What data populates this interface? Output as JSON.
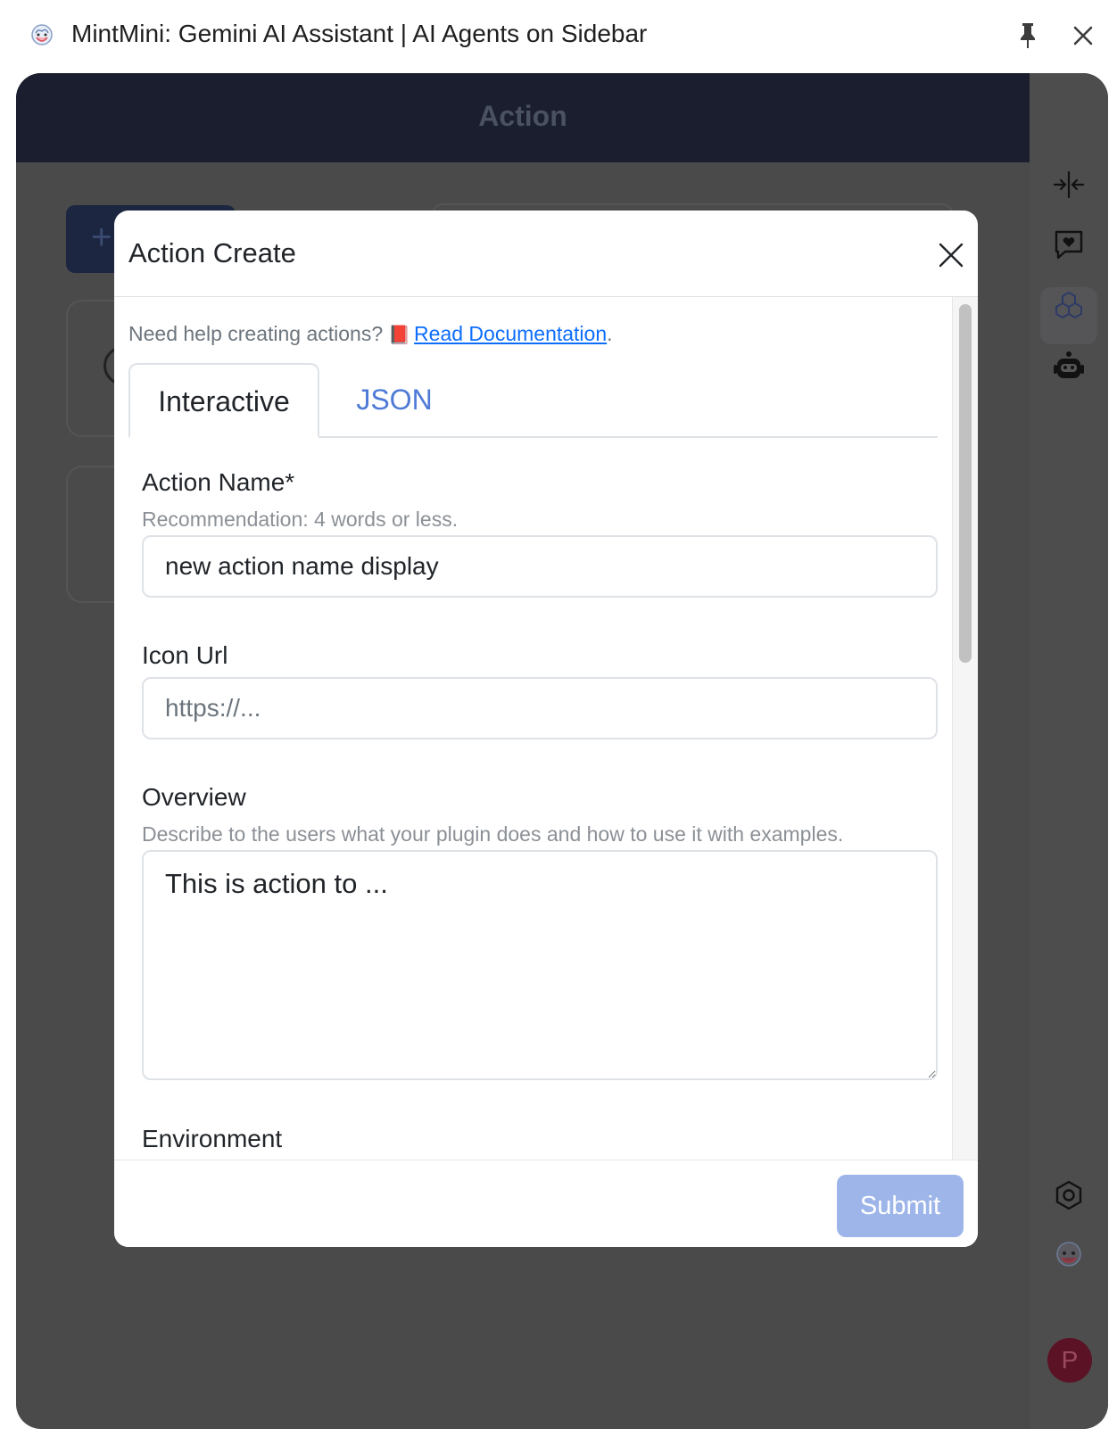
{
  "window": {
    "title": "MintMini: Gemini AI Assistant | AI Agents on Sidebar"
  },
  "main": {
    "header_title": "Action",
    "add_button_icon": "plus-icon"
  },
  "rail": {
    "icons": [
      "collapse-icon",
      "chat-heart-icon",
      "boxes-icon",
      "robot-icon",
      "settings-hexagon-icon",
      "mintmini-logo-icon"
    ],
    "avatar_letter": "P"
  },
  "modal": {
    "title": "Action Create",
    "help_prefix": "Need help creating actions?",
    "help_icon": "📕",
    "help_link": "Read Documentation",
    "help_suffix": ".",
    "tabs": [
      {
        "label": "Interactive",
        "active": true
      },
      {
        "label": "JSON",
        "active": false
      }
    ],
    "fields": {
      "action_name": {
        "label": "Action Name*",
        "hint": "Recommendation: 4 words or less.",
        "value": "new action name display"
      },
      "icon_url": {
        "label": "Icon Url",
        "placeholder": "https://..."
      },
      "overview": {
        "label": "Overview",
        "hint": "Describe to the users what your plugin does and how to use it with examples.",
        "placeholder": "This is action to ..."
      },
      "environment": {
        "label": "Environment"
      }
    },
    "submit_label": "Submit"
  },
  "colors": {
    "accent": "#0d6efd",
    "submit_disabled": "#9eb5ea",
    "header_bg": "#1a1e2e",
    "avatar_bg": "#5b1225"
  }
}
